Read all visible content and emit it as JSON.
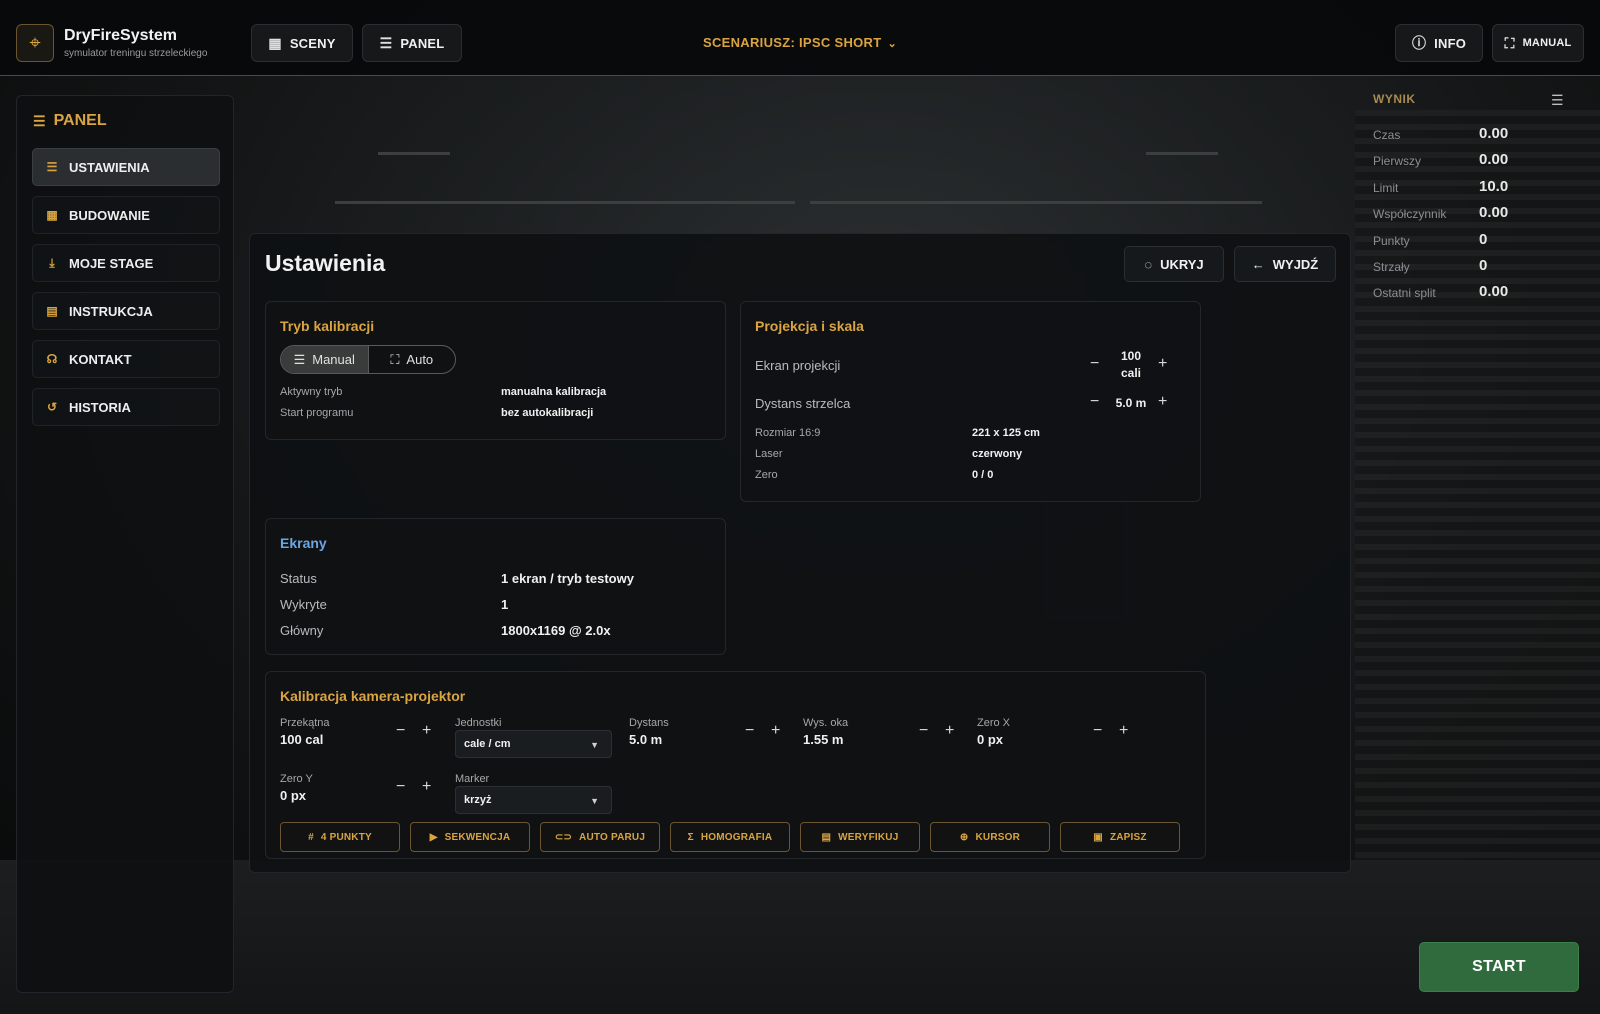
{
  "app": {
    "name": "DryFireSystem",
    "subtitle": "symulator treningu strzeleckiego"
  },
  "topbar": {
    "sceny_label": "SCENY",
    "panel_label": "PANEL",
    "scenario_label": "SCENARIUSZ: IPSC SHORT",
    "info_label": "INFO",
    "manual_label": "MANUAL"
  },
  "sidebar": {
    "title": "PANEL",
    "items": [
      {
        "label": "USTAWIENIA",
        "icon": "sliders-icon"
      },
      {
        "label": "BUDOWANIE",
        "icon": "grid-icon"
      },
      {
        "label": "MOJE STAGE",
        "icon": "download-icon"
      },
      {
        "label": "INSTRUKCJA",
        "icon": "book-icon"
      },
      {
        "label": "KONTAKT",
        "icon": "headset-icon"
      },
      {
        "label": "HISTORIA",
        "icon": "history-icon"
      }
    ]
  },
  "wynik": {
    "title": "WYNIK",
    "rows": [
      {
        "label": "Czas",
        "value": "0.00"
      },
      {
        "label": "Pierwszy",
        "value": "0.00"
      },
      {
        "label": "Limit",
        "value": "10.0"
      },
      {
        "label": "Współczynnik",
        "value": "0.00"
      },
      {
        "label": "Punkty",
        "value": "0"
      },
      {
        "label": "Strzały",
        "value": "0"
      },
      {
        "label": "Ostatni split",
        "value": "0.00"
      }
    ]
  },
  "main": {
    "title": "Ustawienia",
    "hide_label": "UKRYJ",
    "exit_label": "WYJDŹ"
  },
  "calibration_mode": {
    "title": "Tryb kalibracji",
    "options": [
      "Manual",
      "Auto"
    ],
    "selected": "Manual",
    "active_mode_label": "Aktywny tryb",
    "active_mode_value": "manualna kalibracja",
    "program_start_label": "Start programu",
    "program_start_value": "bez autokalibracji"
  },
  "projection": {
    "title": "Projekcja i skala",
    "screen_label": "Ekran projekcji",
    "screen_value_1": "100",
    "screen_value_2": "cali",
    "distance_label": "Dystans strzelca",
    "distance_value": "5.0 m",
    "size_label": "Rozmiar 16:9",
    "size_value": "221 x 125 cm",
    "laser_label": "Laser",
    "laser_value": "czerwony",
    "zero_label": "Zero",
    "zero_value": "0 / 0"
  },
  "screens": {
    "title": "Ekrany",
    "status_label": "Status",
    "status_value": "1 ekran / tryb testowy",
    "detected_label": "Wykryte",
    "detected_value": "1",
    "main_label": "Główny",
    "main_value": "1800x1169 @ 2.0x"
  },
  "camera_calibration": {
    "title": "Kalibracja kamera-projektor",
    "diagonal_label": "Przekątna",
    "diagonal_value": "100 cal",
    "units_label": "Jednostki",
    "units_value": "cale / cm",
    "distance_label": "Dystans",
    "distance_value": "5.0 m",
    "eye_height_label": "Wys. oka",
    "eye_height_value": "1.55 m",
    "zero_x_label": "Zero X",
    "zero_x_value": "0 px",
    "zero_y_label": "Zero Y",
    "zero_y_value": "0 px",
    "marker_label": "Marker",
    "marker_value": "krzyż",
    "actions": [
      {
        "label": "4 PUNKTY",
        "icon": "hash-icon"
      },
      {
        "label": "SEKWENCJA",
        "icon": "play-icon"
      },
      {
        "label": "AUTO PARUJ",
        "icon": "link-icon"
      },
      {
        "label": "HOMOGRAFIA",
        "icon": "sigma-icon"
      },
      {
        "label": "WERYFIKUJ",
        "icon": "checklist-icon"
      },
      {
        "label": "KURSOR",
        "icon": "crosshair-icon"
      },
      {
        "label": "ZAPISZ",
        "icon": "save-icon"
      }
    ]
  },
  "start_label": "START",
  "colors": {
    "accent": "#d9a441",
    "blue_accent": "#6aa6e6",
    "start_green": "#2f6b3c"
  }
}
